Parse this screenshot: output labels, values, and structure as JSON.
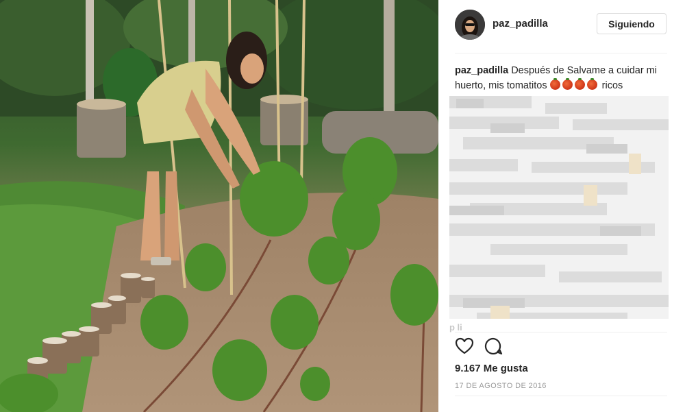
{
  "post": {
    "image": {
      "description_icon": "photo"
    }
  },
  "header": {
    "username": "paz_padilla",
    "follow_label": "Siguiendo"
  },
  "caption": {
    "username": "paz_padilla",
    "text": "Después de Salvame a cuidar mi huerto, mis tomatitos",
    "emoji_count": 4,
    "text_after": "ricos"
  },
  "comments": {
    "partial_visible_text": "p   li"
  },
  "actions": {
    "like_icon": "heart-icon",
    "comment_icon": "comment-icon"
  },
  "likes": {
    "label": "9.167 Me gusta"
  },
  "date": {
    "label": "17 DE AGOSTO DE 2016"
  },
  "colors": {
    "border": "#efefef",
    "text": "#262626",
    "muted": "#999999",
    "tomato": "#d1381a"
  }
}
